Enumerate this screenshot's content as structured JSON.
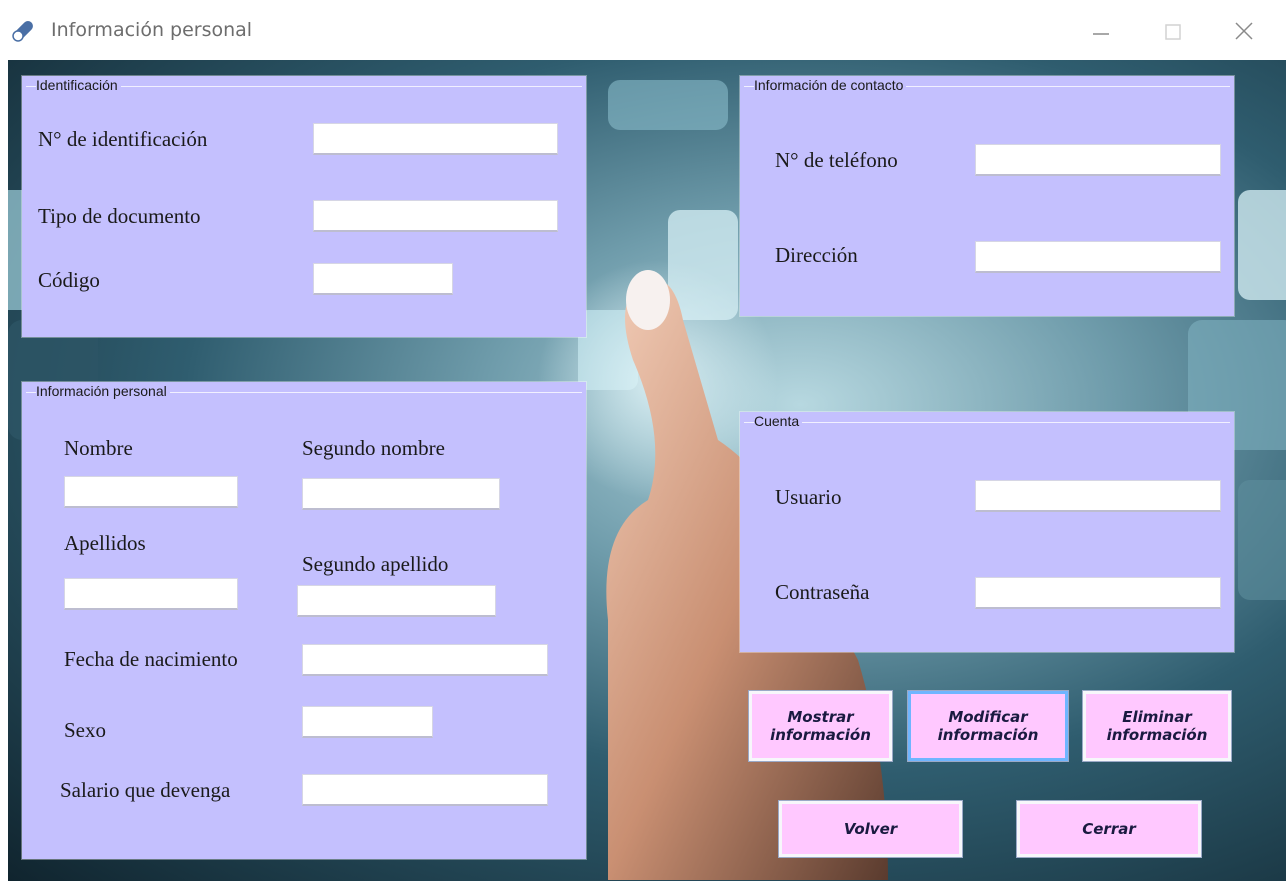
{
  "window": {
    "title": "Información personal",
    "controls": [
      "minimize-icon",
      "maximize-icon",
      "close-icon"
    ]
  },
  "colors": {
    "panel": "#c4c0fe",
    "button": "#ffc8ff",
    "input": "#ffffff",
    "text": "#1a1a1a"
  },
  "identificacion": {
    "legend": "Identificación",
    "id_label": "N° de identificación",
    "id_value": "",
    "doc_type_label": "Tipo de documento",
    "doc_type_value": "",
    "code_label": "Código",
    "code_value": ""
  },
  "contacto": {
    "legend": "Información de contacto",
    "phone_label": "N° de teléfono",
    "phone_value": "",
    "address_label": "Dirección",
    "address_value": ""
  },
  "personal": {
    "legend": "Información personal",
    "first_name_label": "Nombre",
    "first_name_value": "",
    "middle_name_label": "Segundo nombre",
    "middle_name_value": "",
    "last_name_label": "Apellidos",
    "last_name_value": "",
    "second_last_name_label": "Segundo apellido",
    "second_last_name_value": "",
    "birth_date_label": "Fecha de nacimiento",
    "birth_date_value": "",
    "sex_label": "Sexo",
    "sex_value": "",
    "salary_label": "Salario que devenga",
    "salary_value": ""
  },
  "cuenta": {
    "legend": "Cuenta",
    "user_label": "Usuario",
    "user_value": "",
    "password_label": "Contraseña",
    "password_value": ""
  },
  "actions": {
    "show": "Mostrar\ninformación",
    "modify": "Modificar\ninformación",
    "delete": "Eliminar\ninformación",
    "back": "Volver",
    "close": "Cerrar"
  }
}
